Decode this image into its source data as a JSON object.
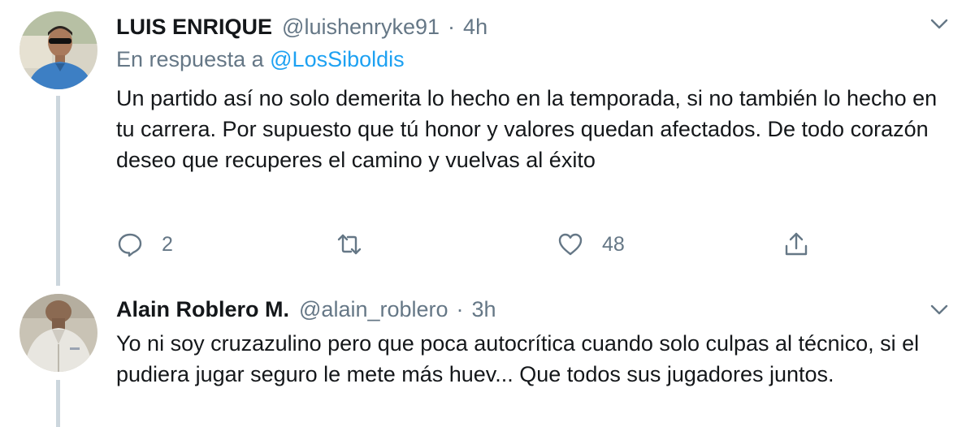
{
  "tweets": [
    {
      "name": "LUIS ENRIQUE",
      "handle": "@luishenryke91",
      "separator": "·",
      "time": "4h",
      "reply_prefix": "En respuesta a",
      "reply_to": "@LosSiboldis",
      "text": "Un partido así no solo demerita lo hecho en la temporada, si no también lo hecho en tu carrera. Por supuesto que tú honor y valores quedan afectados. De todo corazón deseo que recuperes el camino y vuelvas al éxito",
      "replies": "2",
      "likes": "48",
      "avatar_icon": "avatar-man-sunglasses-blue-shirt"
    },
    {
      "name": "Alain Roblero M.",
      "handle": "@alain_roblero",
      "separator": "·",
      "time": "3h",
      "text": "Yo ni soy cruzazulino pero que poca autocrítica cuando solo culpas al técnico, si el pudiera jugar seguro le mete más huev... Que todos sus jugadores juntos.",
      "avatar_icon": "avatar-man-white-shirt"
    }
  ],
  "icons": {
    "more": "chevron-down-icon",
    "reply": "reply-icon",
    "retweet": "retweet-icon",
    "like": "heart-icon",
    "share": "share-icon"
  },
  "colors": {
    "text": "#14171a",
    "muted": "#657786",
    "link": "#1da1f2",
    "thread_line": "#ccd6dd"
  }
}
